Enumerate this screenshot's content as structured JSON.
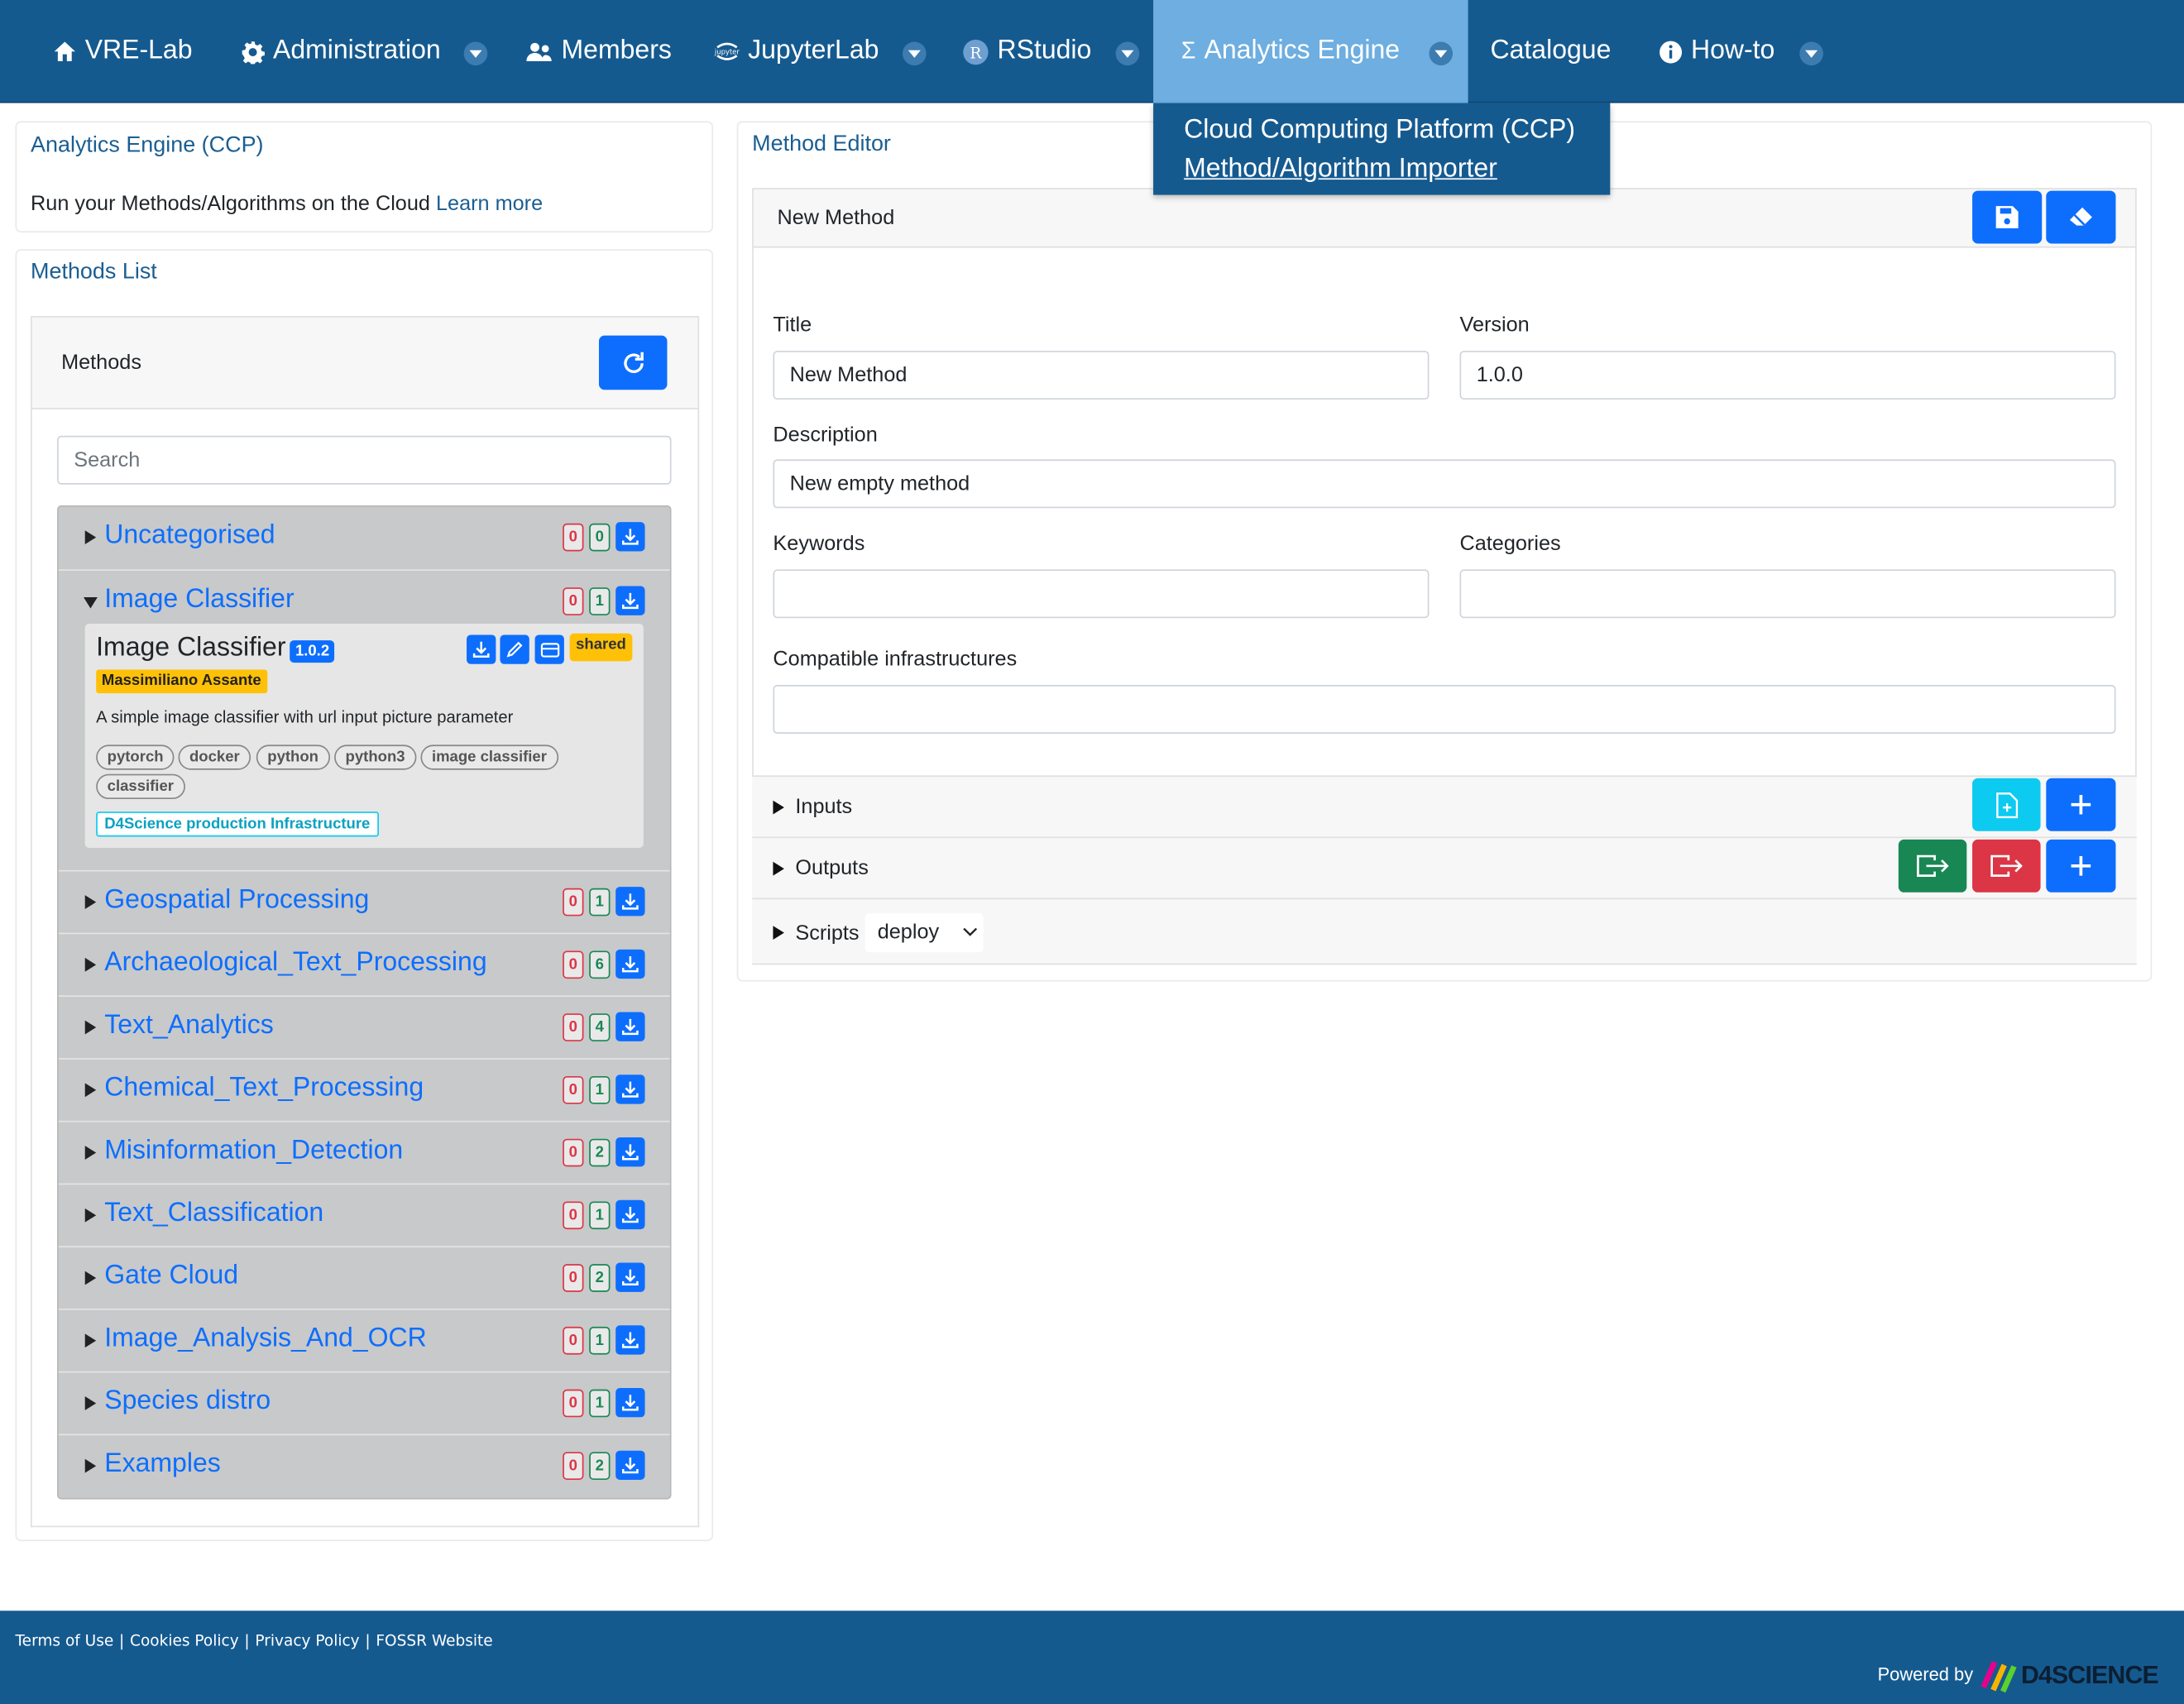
{
  "nav": {
    "items": [
      {
        "label": "VRE-Lab",
        "icon": "home-icon"
      },
      {
        "label": "Administration",
        "icon": "gear-icon"
      },
      {
        "label": "Members",
        "icon": "users-icon"
      },
      {
        "label": "JupyterLab",
        "icon": "jupyter-icon"
      },
      {
        "label": "RStudio",
        "icon": "rstudio-icon"
      },
      {
        "label": "Analytics Engine",
        "icon": "sigma-icon"
      },
      {
        "label": "Catalogue"
      },
      {
        "label": "How-to",
        "icon": "info-icon"
      }
    ],
    "dropdown": [
      "Cloud Computing Platform (CCP)",
      "Method/Algorithm Importer"
    ]
  },
  "intro": {
    "title": "Analytics Engine (CCP)",
    "text": "Run your Methods/Algorithms on the Cloud",
    "link": "Learn more"
  },
  "methods_list": {
    "title": "Methods List",
    "header": "Methods",
    "search_placeholder": "Search",
    "categories": [
      {
        "name": "Uncategorised",
        "red": "0",
        "green": "0",
        "expanded": false
      },
      {
        "name": "Image Classifier",
        "red": "0",
        "green": "1",
        "expanded": true
      },
      {
        "name": "Geospatial Processing",
        "red": "0",
        "green": "1",
        "expanded": false
      },
      {
        "name": "Archaeological_Text_Processing",
        "red": "0",
        "green": "6",
        "expanded": false
      },
      {
        "name": "Text_Analytics",
        "red": "0",
        "green": "4",
        "expanded": false
      },
      {
        "name": "Chemical_Text_Processing",
        "red": "0",
        "green": "1",
        "expanded": false
      },
      {
        "name": "Misinformation_Detection",
        "red": "0",
        "green": "2",
        "expanded": false
      },
      {
        "name": "Text_Classification",
        "red": "0",
        "green": "1",
        "expanded": false
      },
      {
        "name": "Gate Cloud",
        "red": "0",
        "green": "2",
        "expanded": false
      },
      {
        "name": "Image_Analysis_And_OCR",
        "red": "0",
        "green": "1",
        "expanded": false
      },
      {
        "name": "Species distro",
        "red": "0",
        "green": "1",
        "expanded": false
      },
      {
        "name": "Examples",
        "red": "0",
        "green": "2",
        "expanded": false
      }
    ],
    "card": {
      "title": "Image Classifier",
      "version": "1.0.2",
      "shared": "shared",
      "author": "Massimiliano Assante",
      "description": "A simple image classifier with url input picture parameter",
      "tags": [
        "pytorch",
        "docker",
        "python",
        "python3",
        "image classifier",
        "classifier"
      ],
      "infrastructure": "D4Science production Infrastructure"
    }
  },
  "editor": {
    "title": "Method Editor",
    "header": "New Method",
    "fields": {
      "title_label": "Title",
      "title_value": "New Method",
      "version_label": "Version",
      "version_value": "1.0.0",
      "description_label": "Description",
      "description_value": "New empty method",
      "keywords_label": "Keywords",
      "categories_label": "Categories",
      "infra_label": "Compatible infrastructures"
    },
    "sections": {
      "inputs": "Inputs",
      "outputs": "Outputs",
      "scripts": "Scripts",
      "scripts_select": "deploy"
    }
  },
  "footer": {
    "links": [
      "Terms of Use",
      "Cookies Policy",
      "Privacy Policy",
      "FOSSR Website"
    ],
    "powered": "Powered by",
    "brand": "D4SCIENCE"
  },
  "colors": {
    "nav": "#155a8f",
    "accent": "#0d6efd",
    "danger": "#dc3545",
    "success": "#198754",
    "info": "#0dcaf0",
    "warning": "#ffc107"
  }
}
